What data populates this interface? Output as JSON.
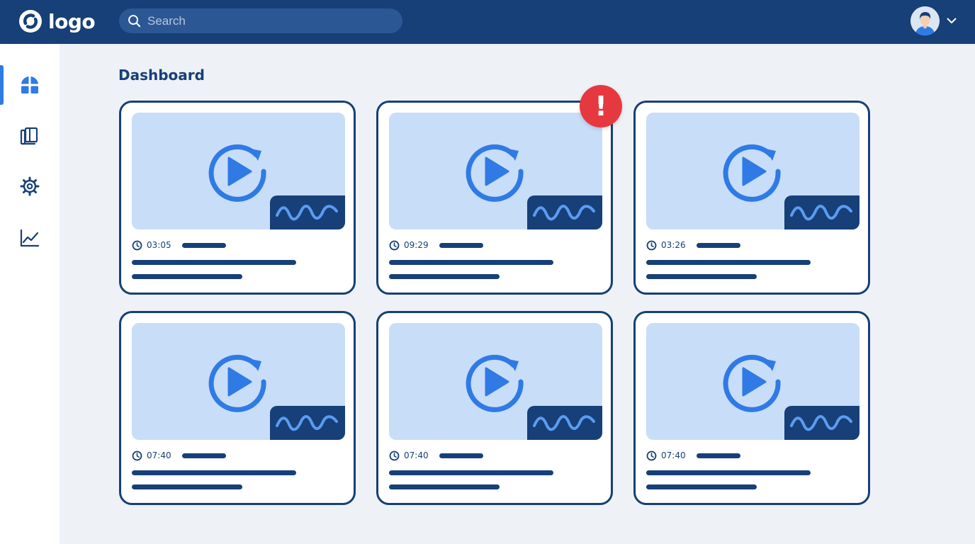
{
  "header": {
    "logo_text": "logo",
    "search": {
      "placeholder": "Search",
      "value": ""
    },
    "user_menu": {
      "avatar_icon": "user-avatar",
      "caret_icon": "chevron-down-icon"
    }
  },
  "sidebar": {
    "items": [
      {
        "name": "dashboard",
        "icon": "dashboard-grid-icon",
        "active": true
      },
      {
        "name": "library",
        "icon": "library-book-icon",
        "active": false
      },
      {
        "name": "settings",
        "icon": "gear-icon",
        "active": false
      },
      {
        "name": "analytics",
        "icon": "line-chart-icon",
        "active": false
      }
    ]
  },
  "main": {
    "title": "Dashboard",
    "cards": [
      {
        "duration": "03:05",
        "alert": false
      },
      {
        "duration": "09:29",
        "alert": true
      },
      {
        "duration": "03:26",
        "alert": false
      },
      {
        "duration": "07:40",
        "alert": false
      },
      {
        "duration": "07:40",
        "alert": false
      },
      {
        "duration": "07:40",
        "alert": false
      }
    ],
    "alert_badge": {
      "text": "!",
      "color": "#e5393f"
    }
  },
  "colors": {
    "primary": "#173f78",
    "accent": "#2f7ae5",
    "thumbnail": "#c8ddf8",
    "background": "#eef2f7",
    "alert": "#e5393f"
  }
}
